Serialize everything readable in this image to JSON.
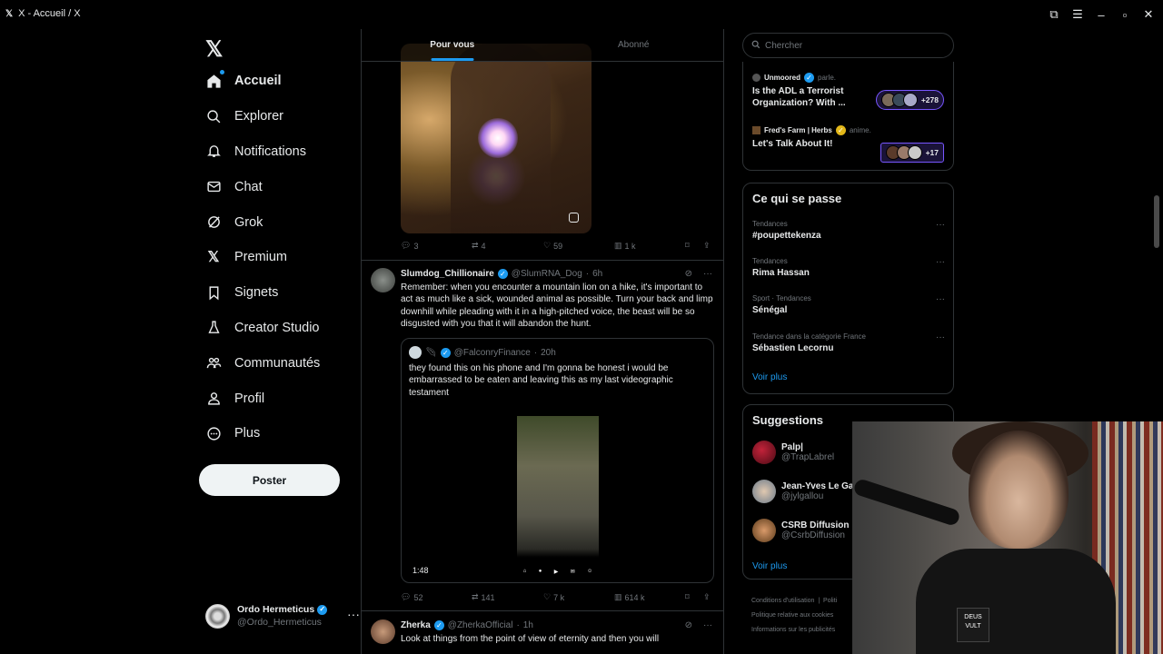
{
  "window": {
    "title": "X - Accueil / X",
    "logo": "X"
  },
  "sidebar": {
    "items": [
      {
        "label": "Accueil",
        "icon": "home-icon"
      },
      {
        "label": "Explorer",
        "icon": "search-icon"
      },
      {
        "label": "Notifications",
        "icon": "bell-icon"
      },
      {
        "label": "Chat",
        "icon": "mail-icon"
      },
      {
        "label": "Grok",
        "icon": "grok-icon"
      },
      {
        "label": "Premium",
        "icon": "x-icon"
      },
      {
        "label": "Signets",
        "icon": "bookmark-icon"
      },
      {
        "label": "Creator Studio",
        "icon": "flask-icon"
      },
      {
        "label": "Communautés",
        "icon": "people-icon"
      },
      {
        "label": "Profil",
        "icon": "person-icon"
      },
      {
        "label": "Plus",
        "icon": "more-circle-icon"
      }
    ],
    "post_label": "Poster",
    "account": {
      "name": "Ordo Hermeticus",
      "handle": "@Ordo_Hermeticus"
    }
  },
  "feed": {
    "tabs": [
      {
        "label": "Pour vous",
        "active": true
      },
      {
        "label": "Abonné",
        "active": false
      }
    ],
    "post1": {
      "replies": "3",
      "reposts": "4",
      "likes": "59",
      "views": "1 k"
    },
    "post2": {
      "name": "Slumdog_Chillionaire",
      "handle": "@SlumRNA_Dog",
      "time": "6h",
      "text": "Remember: when you encounter a mountain lion on a hike, it's important to act as much like a sick, wounded animal as possible. Turn your back and limp downhill while pleading with it in a high-pitched voice, the beast will be so disgusted with you that it will abandon the hunt.",
      "quote": {
        "handle": "@FalconryFinance",
        "time": "20h",
        "text": "they found this on his phone and I'm gonna be honest i would be embarrassed to be eaten and leaving this as my last videographic testament",
        "duration": "1:48"
      },
      "replies": "52",
      "reposts": "141",
      "likes": "7 k",
      "views": "614 k"
    },
    "post3": {
      "name": "Zherka",
      "handle": "@ZherkaOfficial",
      "time": "1h",
      "text": "Look at things from the point of view of eternity and then you will"
    }
  },
  "right": {
    "search_placeholder": "Chercher",
    "spaces": [
      {
        "host": "Unmoored",
        "verb": "parle.",
        "title": "Is the ADL a Terrorist Organization? With ...",
        "count": "+278"
      },
      {
        "host": "Fred's Farm | Herbs",
        "verb": "anime.",
        "title": "Let's Talk About It!",
        "count": "+17"
      }
    ],
    "trends_title": "Ce qui se passe",
    "trends": [
      {
        "context": "Tendances",
        "name": "#poupettekenza"
      },
      {
        "context": "Tendances",
        "name": "Rima Hassan"
      },
      {
        "context": "Sport · Tendances",
        "name": "Sénégal"
      },
      {
        "context": "Tendance dans la catégorie France",
        "name": "Sébastien Lecornu"
      }
    ],
    "see_more": "Voir plus",
    "suggestions_title": "Suggestions",
    "suggestions": [
      {
        "name": "Palp|",
        "handle": "@TrapLabrel"
      },
      {
        "name": "Jean-Yves Le Ga",
        "handle": "@jylgallou"
      },
      {
        "name": "CSRB Diffusion",
        "handle": "@CsrbDiffusion"
      }
    ],
    "suggestions_more": "Voir plus",
    "footer": [
      "Conditions d'utilisation",
      "Politi",
      "Politique relative aux cookies",
      "Informations sur les publicités"
    ]
  },
  "overlay": {
    "patch_text": "DEUS VULT"
  }
}
